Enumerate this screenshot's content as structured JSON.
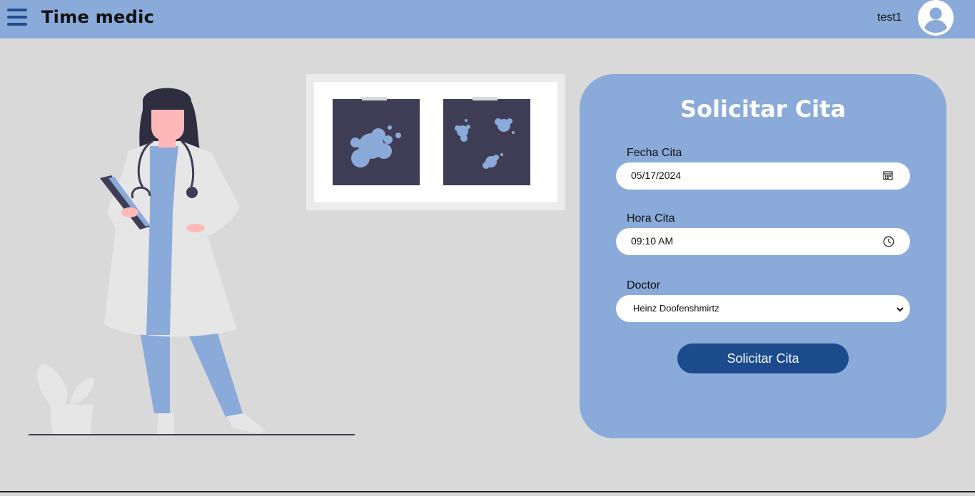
{
  "header": {
    "title": "Time medic",
    "username": "test1"
  },
  "form": {
    "title": "Solicitar Cita",
    "date_label": "Fecha Cita",
    "date_value": "05/17/2024",
    "time_label": "Hora Cita",
    "time_value": "09:10 AM",
    "doctor_label": "Doctor",
    "doctor_value": "Heinz Doofenshmirtz",
    "submit_label": "Solicitar Cita"
  },
  "icons": {
    "menu": "hamburger-menu-icon",
    "avatar": "user-avatar-icon",
    "calendar": "calendar-icon",
    "clock": "clock-icon",
    "dropdown": "chevron-down-icon"
  },
  "colors": {
    "header_bg": "#8aaad9",
    "page_bg": "#d9d9d9",
    "card_bg": "#8aaad9",
    "button_bg": "#1b4b8c",
    "xray_bg": "#3f3d56"
  }
}
